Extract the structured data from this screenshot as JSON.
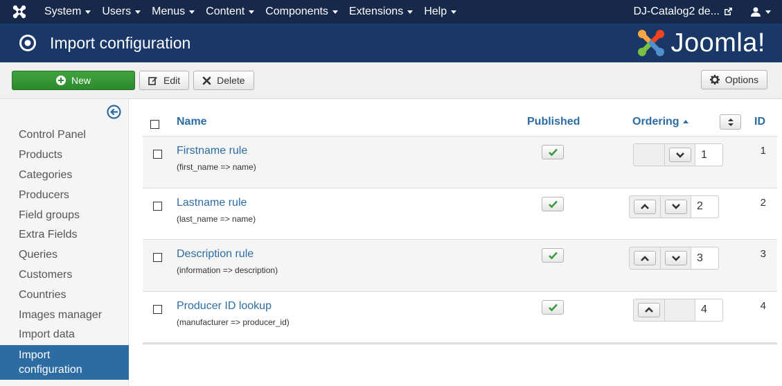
{
  "navbar": {
    "menus": [
      "System",
      "Users",
      "Menus",
      "Content",
      "Components",
      "Extensions",
      "Help"
    ],
    "site_link": "DJ-Catalog2 de..."
  },
  "header": {
    "title": "Import configuration",
    "brand": "Joomla!"
  },
  "toolbar": {
    "new": "New",
    "edit": "Edit",
    "delete": "Delete",
    "options": "Options"
  },
  "sidebar": {
    "items": [
      "Control Panel",
      "Products",
      "Categories",
      "Producers",
      "Field groups",
      "Extra Fields",
      "Queries",
      "Customers",
      "Countries",
      "Images manager",
      "Import data",
      "Import configuration"
    ],
    "active": "Import configuration"
  },
  "table": {
    "headers": {
      "name": "Name",
      "published": "Published",
      "ordering": "Ordering",
      "id": "ID"
    },
    "rows": [
      {
        "name": "Firstname rule",
        "mapping": "(first_name => name)",
        "order": "1",
        "id": "1"
      },
      {
        "name": "Lastname rule",
        "mapping": "(last_name => name)",
        "order": "2",
        "id": "2"
      },
      {
        "name": "Description rule",
        "mapping": "(information => description)",
        "order": "3",
        "id": "3"
      },
      {
        "name": "Producer ID lookup",
        "mapping": "(manufacturer => producer_id)",
        "order": "4",
        "id": "4"
      }
    ]
  },
  "colors": {
    "navbar": "#17294b",
    "header": "#1a3867",
    "link": "#2d6ca2",
    "new_button": "#3ea33e",
    "active_sidebar": "#2d6ca2",
    "check": "#3b9a3b"
  }
}
